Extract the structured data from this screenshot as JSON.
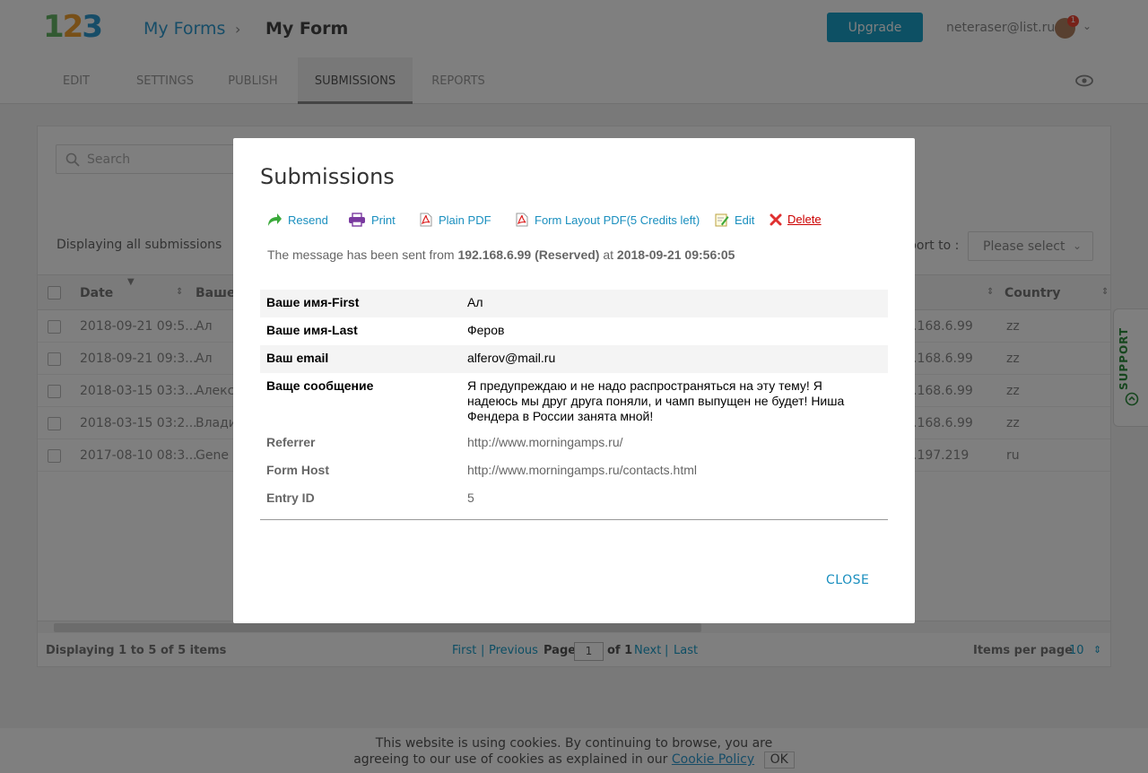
{
  "colors": {
    "accent": "#1a9dc9",
    "brand_blue": "#2e9ad0",
    "brand_orange": "#f0a030",
    "brand_green": "#64b464",
    "upgrade_bg": "#1aa0c8",
    "support_green": "#2d8c3c",
    "delete_red": "#cc0000"
  },
  "header": {
    "logo_text": "123",
    "breadcrumb_root": "My Forms",
    "breadcrumb_current": "My Form",
    "upgrade_label": "Upgrade",
    "user_email": "neteraser@list.ru",
    "notif_count": "1"
  },
  "tabs": [
    {
      "label": "EDIT"
    },
    {
      "label": "SETTINGS"
    },
    {
      "label": "PUBLISH"
    },
    {
      "label": "SUBMISSIONS"
    },
    {
      "label": "REPORTS"
    }
  ],
  "toolbar": {
    "search_placeholder": "Search",
    "displaying_all": "Displaying all submissions",
    "export_label": "port to :",
    "export_select": "Please select"
  },
  "grid": {
    "columns": [
      "Date",
      "Ваше",
      "Country"
    ],
    "rows": [
      {
        "date": "2018-09-21 09:5...",
        "name": "Ал",
        "ip": ".168.6.99",
        "country": "zz"
      },
      {
        "date": "2018-09-21 09:3...",
        "name": "Ал",
        "ip": ".168.6.99",
        "country": "zz"
      },
      {
        "date": "2018-03-15 03:3...",
        "name": "Алекс",
        "ip": ".168.6.99",
        "country": "zz"
      },
      {
        "date": "2018-03-15 03:2...",
        "name": "Влади",
        "ip": ".168.6.99",
        "country": "zz"
      },
      {
        "date": "2017-08-10 08:3...",
        "name": "Gene",
        "ip": ".197.219",
        "country": "ru"
      }
    ]
  },
  "pager": {
    "summary": "Displaying 1 to 5 of 5 items",
    "first": "First",
    "previous": "Previous",
    "page_label": "Page",
    "page_value": "1",
    "of_label": "of 1",
    "next": "Next",
    "last": "Last",
    "items_per_page_label": "Items per page",
    "items_per_page": "10",
    "sep": "|"
  },
  "support_label": "SUPPORT",
  "cookie": {
    "line1": "This website is using cookies. By continuing to browse, you are",
    "line2": "agreeing to our use of cookies as explained in our",
    "link": "Cookie Policy",
    "ok": "OK"
  },
  "modal": {
    "title": "Submissions",
    "actions": {
      "resend": "Resend",
      "print": "Print",
      "plain_pdf": "Plain PDF",
      "layout_pdf": "Form Layout PDF(5 Credits left)",
      "edit": "Edit",
      "delete": "Delete"
    },
    "info_prefix": "The message has been sent from",
    "info_ip": "192.168.6.99 (Reserved)",
    "info_at": "at",
    "info_time": "2018-09-21 09:56:05",
    "fields": [
      {
        "label": "Ваше имя-First",
        "value": "Ал"
      },
      {
        "label": "Ваше имя-Last",
        "value": "Феров"
      },
      {
        "label": "Ваш email",
        "value": "alferov@mail.ru"
      },
      {
        "label": "Ваще сообщение",
        "value": "Я предупреждаю и не надо распространяться на эту тему! Я надеюсь мы друг друга поняли, и чамп выпущен не будет! Ниша Фендера в России занята мной!"
      }
    ],
    "meta": [
      {
        "label": "Referrer",
        "value": "http://www.morningamps.ru/"
      },
      {
        "label": "Form Host",
        "value": "http://www.morningamps.ru/contacts.html"
      },
      {
        "label": "Entry ID",
        "value": "5"
      }
    ],
    "close_label": "CLOSE"
  }
}
